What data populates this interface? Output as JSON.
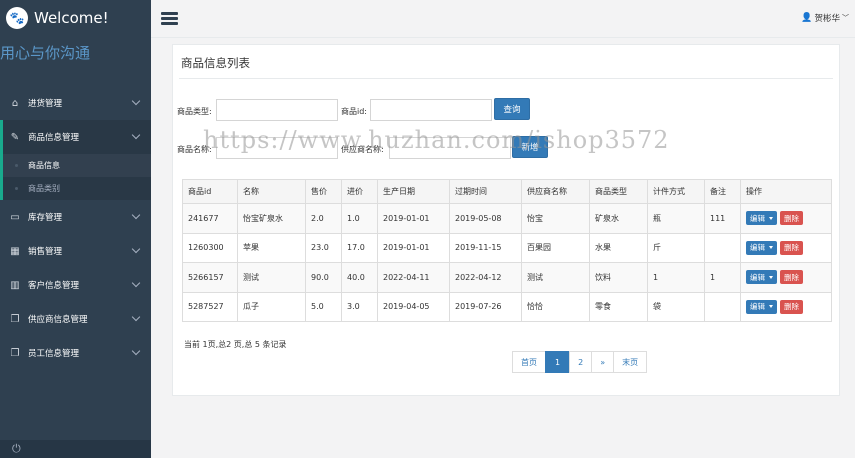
{
  "brand": {
    "title": "Welcome!",
    "icon": "paw-icon",
    "slogan": "用心与你沟通"
  },
  "sidebar": {
    "items": [
      {
        "label": "进货管理",
        "icon": "home-icon"
      },
      {
        "label": "商品信息管理",
        "icon": "edit-icon",
        "active": true,
        "children": [
          {
            "label": "商品信息",
            "current": true
          },
          {
            "label": "商品类别"
          }
        ]
      },
      {
        "label": "库存管理",
        "icon": "monitor-icon"
      },
      {
        "label": "销售管理",
        "icon": "table-icon"
      },
      {
        "label": "客户信息管理",
        "icon": "bar-chart-icon"
      },
      {
        "label": "供应商信息管理",
        "icon": "copy-icon"
      },
      {
        "label": "员工信息管理",
        "icon": "copy-icon"
      }
    ]
  },
  "topbar": {
    "user": "贺彬华"
  },
  "panel": {
    "title": "商品信息列表"
  },
  "form": {
    "type_label": "商品类型:",
    "id_label": "商品id:",
    "query_button": "查询",
    "name_label": "商品名称:",
    "supplier_label": "供应商名称:",
    "add_button": "新增"
  },
  "table": {
    "headers": [
      "商品id",
      "名称",
      "售价",
      "进价",
      "生产日期",
      "过期时间",
      "供应商名称",
      "商品类型",
      "计件方式",
      "备注",
      "操作"
    ],
    "rows": [
      [
        "241677",
        "怡宝矿泉水",
        "2.0",
        "1.0",
        "2019-01-01",
        "2019-05-08",
        "怡宝",
        "矿泉水",
        "瓶",
        "111"
      ],
      [
        "1260300",
        "苹果",
        "23.0",
        "17.0",
        "2019-01-01",
        "2019-11-15",
        "百果园",
        "水果",
        "斤",
        ""
      ],
      [
        "5266157",
        "测试",
        "90.0",
        "40.0",
        "2022-04-11",
        "2022-04-12",
        "测试",
        "饮料",
        "1",
        "1"
      ],
      [
        "5287527",
        "瓜子",
        "5.0",
        "3.0",
        "2019-04-05",
        "2019-07-26",
        "恰恰",
        "零食",
        "袋",
        ""
      ]
    ],
    "edit_label": "编辑",
    "delete_label": "删除"
  },
  "pagination": {
    "info": "当前 1页,总2 页,总 5 条记录",
    "first": "首页",
    "pages": [
      "1",
      "2"
    ],
    "next": "»",
    "last": "末页",
    "current": "1"
  },
  "watermark": "https://www.huzhan.com/ishop3572",
  "colors": {
    "sidebar": "#2f4050",
    "primary": "#337ab7",
    "danger": "#d9534f",
    "accent": "#19aa8d"
  }
}
